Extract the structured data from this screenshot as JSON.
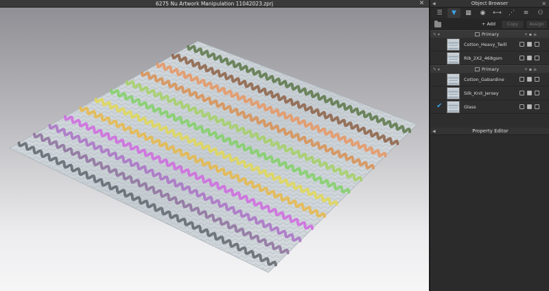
{
  "viewport": {
    "title": "6275 Nu Artwork Manipulation 11042023.zprj"
  },
  "object_browser": {
    "title": "Object Browser",
    "tabs": [
      "list-icon",
      "tshirt-icon",
      "fabric-icon",
      "button-icon",
      "zipper-icon",
      "topstitch-icon",
      "trim-icon",
      "avatar-icon"
    ],
    "actions": {
      "add": "+ Add",
      "copy": "Copy",
      "assign": "Assign"
    },
    "groups": [
      {
        "title": "Primary",
        "items": [
          {
            "label": "Cotton_Heavy_Twill"
          },
          {
            "label": "Rib_2X2_468gsm"
          }
        ]
      },
      {
        "title": "Primary",
        "items": [
          {
            "label": "Cotton_Gabardine"
          },
          {
            "label": "Silk_Knit_Jersey"
          },
          {
            "label": "Glass",
            "checked": true
          }
        ]
      }
    ]
  },
  "property_editor": {
    "title": "Property Editor"
  },
  "colors": {
    "accent": "#3aa3e6",
    "panel_bg": "#2e2e2e"
  },
  "stripes": [
    {
      "color": "#55713f"
    },
    {
      "color": "#8a5a3c"
    },
    {
      "color": "#e8925a"
    },
    {
      "color": "#d98c4a"
    },
    {
      "color": "#a3cf5e"
    },
    {
      "color": "#7ed05f"
    },
    {
      "color": "#e2d84e"
    },
    {
      "color": "#e8b63e"
    },
    {
      "color": "#d063e0"
    },
    {
      "color": "#a86cc4"
    },
    {
      "color": "#8a6a9a"
    },
    {
      "color": "#5a5f66"
    }
  ]
}
